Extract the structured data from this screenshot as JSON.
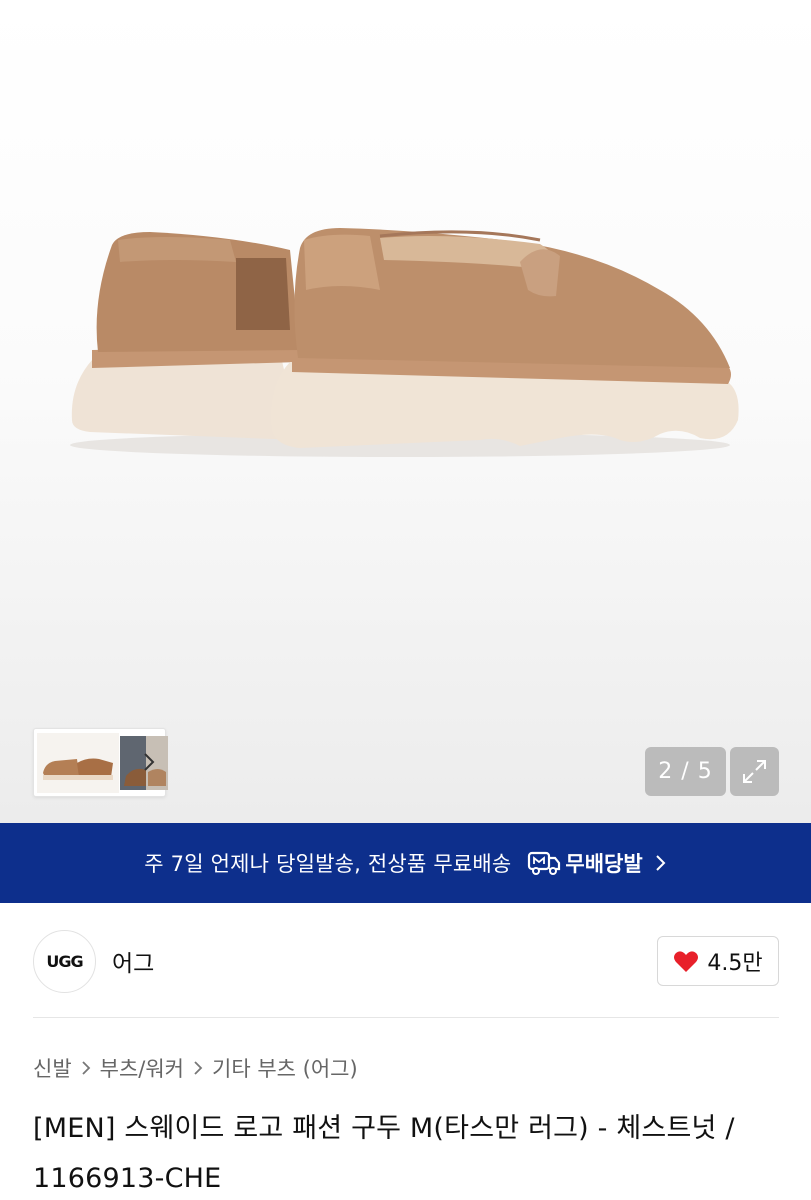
{
  "gallery": {
    "current_page": 2,
    "total_pages": 5,
    "page_counter": "2 / 5",
    "thumbnail_count": 2
  },
  "banner": {
    "text": "주 7일 언제나 당일발송, 전상품 무료배송",
    "badge_label": "무배당발",
    "badge_icon": "delivery-truck-icon",
    "background": "#0d2f8c"
  },
  "brand": {
    "logo_text": "UGG",
    "name": "어그",
    "likes": "4.5만",
    "like_color": "#e8202a"
  },
  "breadcrumb": {
    "items": [
      "신발",
      "부츠/워커",
      "기타 부츠 (어그)"
    ]
  },
  "product": {
    "title": "[MEN] 스웨이드 로고 패션 구두 M(타스만 러그) - 체스트넛 / 1166913-CHE"
  }
}
